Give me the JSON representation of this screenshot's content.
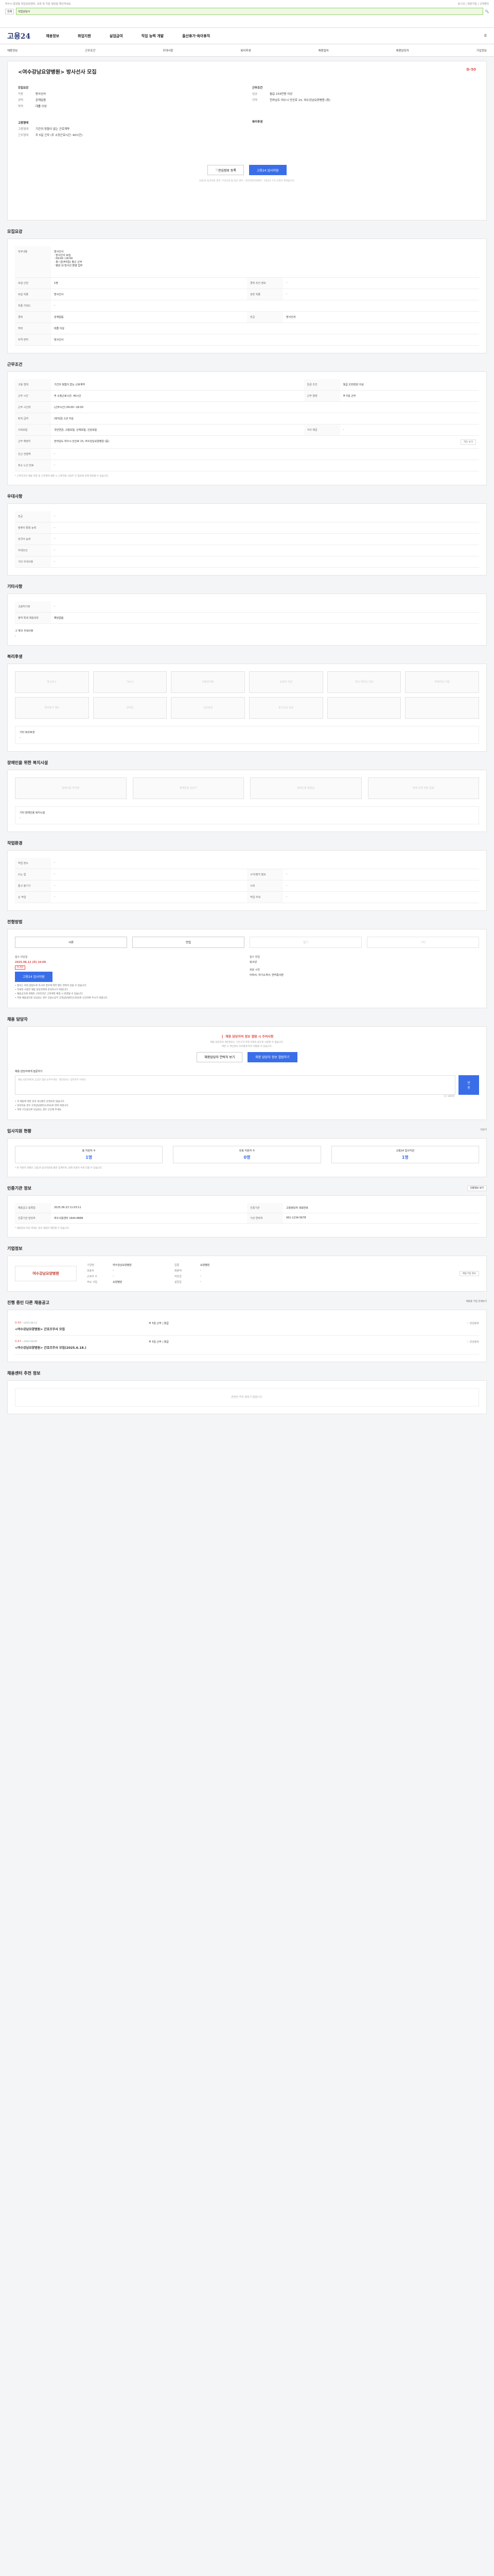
{
  "topbar": {
    "left": "여수시 중앙동 직업상담센터, 교육 및 지원 정보를 확인하세요",
    "right": "로그인 | 회원가입 | 고객센터",
    "badge": "전체",
    "search": "직업상담사"
  },
  "nav": {
    "logo": "고용24",
    "items": [
      "채용정보",
      "취업지원",
      "실업급여",
      "직업 능력 개발",
      "출산휴가·육아휴직"
    ]
  },
  "subnav": {
    "items": [
      "채용정보",
      "근무조건",
      "우대사항",
      "복리후생",
      "채용절차",
      "채용담당자",
      "기업정보"
    ]
  },
  "job": {
    "title": "<여수강남요양병원> 방사선사 모집",
    "dday": "D-50",
    "recruit_h": "모집요강",
    "recruit": [
      [
        "직종",
        "방사선사"
      ],
      [
        "경력",
        "관계없음"
      ],
      [
        "학력",
        "대졸 이상"
      ]
    ],
    "condition_h": "근무조건",
    "condition": [
      [
        "임금",
        "월급 233만원 이상"
      ],
      [
        "지역",
        "전라남도 여수시 안산로 15, 여수강남요양병원 (동)"
      ]
    ],
    "form_h": "고용형태",
    "form": [
      [
        "고용형태",
        "기간의 정함이 없는 근로계약"
      ],
      [
        "근무형태",
        "주 5일 근무 (주 소정근로시간: 40시간)"
      ]
    ],
    "welfare_h": "복리후생",
    "btn_scrap": "관심정보 등록",
    "btn_apply": "고용24 입사지원",
    "note": "고용24 입사지원 결과 '구인인증'을 받은 경우, '국민취업지원제도' 고용24 구직 신청이 완료됩니다."
  },
  "recruit": {
    "title": "모집요강",
    "rows": [
      [
        "직무내용",
        "방사선사\n· 방사선사 모집\n· 09:00~18:00\n· 월~금(주5일) 출근 근무\n· 병원 내 방사선 촬영 업무"
      ],
      [
        "모집 인원",
        "1명"
      ],
      [
        "모집 직종",
        "방사선사"
      ],
      [
        "직종 키워드",
        "-"
      ],
      [
        "경력",
        "관계없음"
      ],
      [
        "학력",
        "대졸 이상"
      ],
      [
        "자격 면허",
        "방사선사"
      ]
    ],
    "right": [
      [
        "경력 조건 정보",
        "-"
      ],
      [
        "관련 직종",
        "-"
      ],
      [
        "전공",
        "방사선과"
      ]
    ]
  },
  "work": {
    "title": "근무조건",
    "rows": [
      [
        "고용 형태",
        "기간의 정함이 없는 근로계약",
        "임금 조건",
        "월급 233만원 이상"
      ],
      [
        "근무 시간",
        "주 소정근로시간: 40시간",
        "근무 형태",
        "주 5일 근무"
      ],
      [
        "근무 시간대",
        "(근무시간) 09:00~18:00",
        "",
        ""
      ],
      [
        "퇴직 급여",
        "(퇴직금) 1년 이상",
        "",
        ""
      ],
      [
        "사회보험",
        "국민연금, 고용보험, 산재보험, 건강보험",
        "식사 제공",
        "-"
      ],
      [
        "근무 예정지",
        "전라남도 여수시 안산로 15, 여수강남요양병원 (동)",
        "",
        ""
      ],
      [
        "인근 전철역",
        "-",
        "",
        ""
      ],
      [
        "최소 노선 번호",
        "-",
        "",
        ""
      ]
    ],
    "map_btn": "지도 보기",
    "note": "* 근로조건은 채용 과정 및 근로계약 체결 시 근로자와 사업주 간 협의에 의해 변경될 수 있습니다."
  },
  "prefer": {
    "title": "우대사항",
    "rows": [
      [
        "전공",
        "-"
      ],
      [
        "컴퓨터 활용 능력",
        "-"
      ],
      [
        "외국어 능력",
        "-"
      ],
      [
        "우대조건",
        "-"
      ],
      [
        "기타 우대사항",
        "-"
      ]
    ]
  },
  "other": {
    "title": "기타사항",
    "rows": [
      [
        "고용허가제",
        "-"
      ],
      [
        "병역 특례 채용희망",
        "해당없음"
      ]
    ],
    "etc_label": "그 밖의 우대사항",
    "etc_val": "-"
  },
  "welfare": {
    "title": "복리후생",
    "items": [
      "통근버스",
      "기숙사",
      "차량유지비",
      "교육비 지원",
      "자녀 학자금 지원",
      "주택자금 지원",
      "경조휴가 제도",
      "상여금",
      "건강검진",
      "장기근속 포상",
      "",
      ""
    ],
    "etc_label": "기타 복리후생",
    "etc_val": "-"
  },
  "disabled": {
    "title": "장애인을 위한 복지시설",
    "items": [
      "장애인용 주차장",
      "장애인용 승강기",
      "장애인용 화장실",
      "장애 유형 제한 없음"
    ],
    "etc_label": "기타 장애인용 복지시설",
    "etc_val": "-"
  },
  "env": {
    "title": "작업환경",
    "rows": [
      [
        "작업 장소",
        "-",
        "",
        ""
      ],
      [
        "드는 힘",
        "-",
        "시각/청각 필요",
        "-"
      ],
      [
        "들고 옮기기",
        "-",
        "시력",
        "-"
      ],
      [
        "손 작업",
        "-",
        "작업 자세",
        "-"
      ]
    ]
  },
  "process": {
    "title": "전형방법",
    "steps": [
      "서류",
      "면접",
      "필기",
      "기타"
    ],
    "deadline_label": "접수 마감일",
    "deadline": "2025.08.12 (화) 16:00",
    "dday": "D-50",
    "method_label": "접수 방법",
    "method": "워크넷",
    "apply_btn": "고용24 입사지원",
    "doc_label": "제출 서류",
    "doc": "이력서, 자기소개서, 면허증사본",
    "bullets": [
      "• 접수는 위의 방법으로 하시며 경우에 따라 별도 연락이 있을 수 있습니다.",
      "• 자세한 사항은 채용 담당자에게 문의하시기 바랍니다.",
      "• 채용공고에 게재된 근로조건은 근로계약 체결 시 변경될 수 있습니다.",
      "• 허위 채용광고로 의심되는 경우 고용노동부 고객상담센터(1350)로 신고하여 주시기 바랍니다."
    ]
  },
  "contact": {
    "title": "채용 담당자",
    "warn": "채용 담당자의 정보 열람 시 주의사항",
    "desc": "채용 담당자의 개인정보는 구인구직 목적 이외의 용도로 사용할 수 없습니다.",
    "desc2": "위반 시 개인정보 보호법에 따라 처벌될 수 있습니다.",
    "btn_phone": "채용담당자 연락처 보기",
    "btn_qa": "채용 담당자 정보 열람하기",
    "qa_label": "채용 담당자에게 질문하기",
    "qa_placeholder": "채용 담당자에게 궁금한 점을 남겨주세요. 개인정보는 입력하지 마세요.",
    "qa_count": "0 / 300자",
    "qa_btn": "전송",
    "notes": [
      "• 이 채용에 대한 문의 게시판은 운영되지 않습니다.",
      "• 문의하실 경우 고객상담센터(1350)로 연락 바랍니다.",
      "• 허위 구인광고로 의심되는 경우 신고해 주세요."
    ]
  },
  "stats": {
    "title": "입사지원 현황",
    "more": "더보기",
    "items": [
      [
        "총 지원자 수",
        "1명"
      ],
      [
        "유효 지원자 수",
        "0명"
      ],
      [
        "고용24 입사지원",
        "1명"
      ]
    ],
    "note": "* 본 지원자 현황은 고용24 입사지원을 통한 집계이며, 실제 지원자 수와 다를 수 있습니다."
  },
  "hrinfo": {
    "title": "인증기관 정보",
    "btn": "인증정보 보기",
    "rows": [
      [
        "채용공고 등록일",
        "2025.06.23 11:03:11",
        "인증기관",
        "고용정보자 대표번호"
      ],
      [
        "인증기관 담당자",
        "여수고용센터 1644-8888",
        "기관 연락처",
        "061-1234-5678"
      ]
    ],
    "note": "* 채용정보 마감 후에는 정보 열람이 제한될 수 있습니다."
  },
  "company": {
    "title": "기업정보",
    "logo": "여수강남요양병원",
    "btn": "채용기업 정보",
    "rows": [
      [
        "기업명",
        "여수강남요양병원",
        "업종",
        "요양병원"
      ],
      [
        "대표자",
        "-",
        "매출액",
        "-"
      ],
      [
        "근로자 수",
        "-",
        "자본금",
        "-"
      ],
      [
        "주요 사업",
        "요양병원",
        "설립일",
        "-"
      ]
    ]
  },
  "others": {
    "title": "진행 중인 다른 채용공고",
    "more": "채용중 기업 전체보기",
    "items": [
      {
        "dday": "D-50",
        "date": "~2025.08.12",
        "title": "<여수강남요양병원> 간호조무사 모집",
        "sub": "주 5일 근무 | 월급",
        "scrap": "관심정보"
      },
      {
        "dday": "D-47",
        "date": "~2025.08.09",
        "title": "<여수강남요양병원> 간호조무사 모집(2025.6.18.)",
        "sub": "주 5일 근무 | 월급",
        "scrap": "관심정보"
      }
    ]
  },
  "recommend": {
    "title": "채용센터 추천 정보",
    "empty": "관련된 추천 정보가 없습니다."
  }
}
